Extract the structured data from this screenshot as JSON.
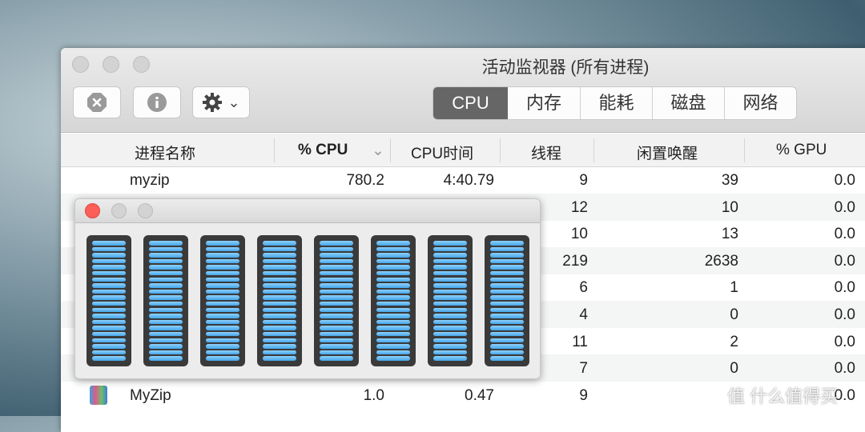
{
  "window": {
    "title": "活动监视器 (所有进程)"
  },
  "toolbar": {
    "stop_icon": "x-octagon-icon",
    "info_icon": "info-icon",
    "gear_icon": "gear-icon",
    "gear_chevron": "⌄",
    "tabs": [
      {
        "label": "CPU",
        "active": true
      },
      {
        "label": "内存"
      },
      {
        "label": "能耗"
      },
      {
        "label": "磁盘"
      },
      {
        "label": "网络"
      }
    ]
  },
  "table": {
    "columns": [
      "进程名称",
      "% CPU",
      "CPU时间",
      "线程",
      "闲置唤醒",
      "% GPU"
    ],
    "sort_indicator": "⌄",
    "rows": [
      {
        "name": "myzip",
        "cpu": "780.2",
        "time": "4:40.79",
        "threads": "9",
        "wakeups": "39",
        "gpu": "0.0"
      },
      {
        "name": "",
        "cpu": "",
        "time": "",
        "threads": "12",
        "wakeups": "10",
        "gpu": "0.0"
      },
      {
        "name": "",
        "cpu": "",
        "time": "",
        "threads": "10",
        "wakeups": "13",
        "gpu": "0.0"
      },
      {
        "name": "",
        "cpu": "",
        "time": "",
        "threads": "219",
        "wakeups": "2638",
        "gpu": "0.0"
      },
      {
        "name": "",
        "cpu": "",
        "time": "",
        "threads": "6",
        "wakeups": "1",
        "gpu": "0.0"
      },
      {
        "name": "",
        "cpu": "",
        "time": "",
        "threads": "4",
        "wakeups": "0",
        "gpu": "0.0"
      },
      {
        "name": "",
        "cpu": "",
        "time": "",
        "threads": "11",
        "wakeups": "2",
        "gpu": "0.0"
      },
      {
        "name": "",
        "cpu": "",
        "time": "",
        "threads": "7",
        "wakeups": "0",
        "gpu": "0.0"
      },
      {
        "name": "MyZip",
        "cpu": "1.0",
        "time": "0.47",
        "threads": "9",
        "wakeups": "",
        "gpu": "0.0",
        "icon": "archive-books-icon"
      }
    ]
  },
  "cpu_history": {
    "cores": 8,
    "load_percent": [
      100,
      100,
      100,
      100,
      100,
      100,
      100,
      100
    ],
    "segments": 20,
    "color": "#4aa9ec"
  },
  "watermark": "值 什么值得买"
}
